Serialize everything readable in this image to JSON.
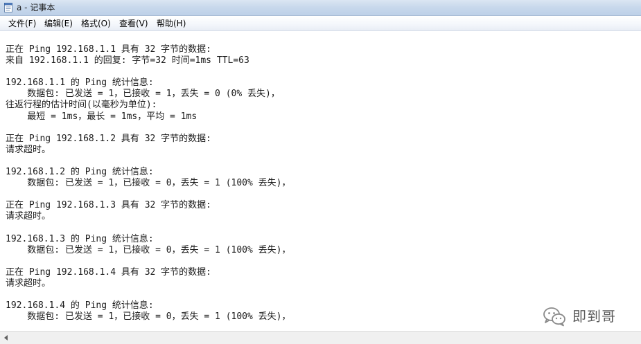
{
  "window": {
    "title": "a - 记事本"
  },
  "menu": {
    "items": [
      {
        "label": "文件(F)"
      },
      {
        "label": "编辑(E)"
      },
      {
        "label": "格式(O)"
      },
      {
        "label": "查看(V)"
      },
      {
        "label": "帮助(H)"
      }
    ]
  },
  "editor": {
    "lines": [
      "正在 Ping 192.168.1.1 具有 32 字节的数据:",
      "来自 192.168.1.1 的回复: 字节=32 时间=1ms TTL=63",
      "",
      "192.168.1.1 的 Ping 统计信息:",
      "    数据包: 已发送 = 1，已接收 = 1，丢失 = 0 (0% 丢失)，",
      "往返行程的估计时间(以毫秒为单位):",
      "    最短 = 1ms，最长 = 1ms，平均 = 1ms",
      "",
      "正在 Ping 192.168.1.2 具有 32 字节的数据:",
      "请求超时。",
      "",
      "192.168.1.2 的 Ping 统计信息:",
      "    数据包: 已发送 = 1，已接收 = 0，丢失 = 1 (100% 丢失)，",
      "",
      "正在 Ping 192.168.1.3 具有 32 字节的数据:",
      "请求超时。",
      "",
      "192.168.1.3 的 Ping 统计信息:",
      "    数据包: 已发送 = 1，已接收 = 0，丢失 = 1 (100% 丢失)，",
      "",
      "正在 Ping 192.168.1.4 具有 32 字节的数据:",
      "请求超时。",
      "",
      "192.168.1.4 的 Ping 统计信息:",
      "    数据包: 已发送 = 1，已接收 = 0，丢失 = 1 (100% 丢失)，"
    ]
  },
  "watermark": {
    "icon": "wechat-icon",
    "text": "即到哥"
  },
  "icons": {
    "app": "notepad-icon",
    "scroll_left": "arrow-left-icon"
  },
  "colors": {
    "titlebar": "#c9d9ec",
    "menubar": "#f3f6fb",
    "text": "#1a1a1a",
    "watermark": "#5a5a5a"
  }
}
